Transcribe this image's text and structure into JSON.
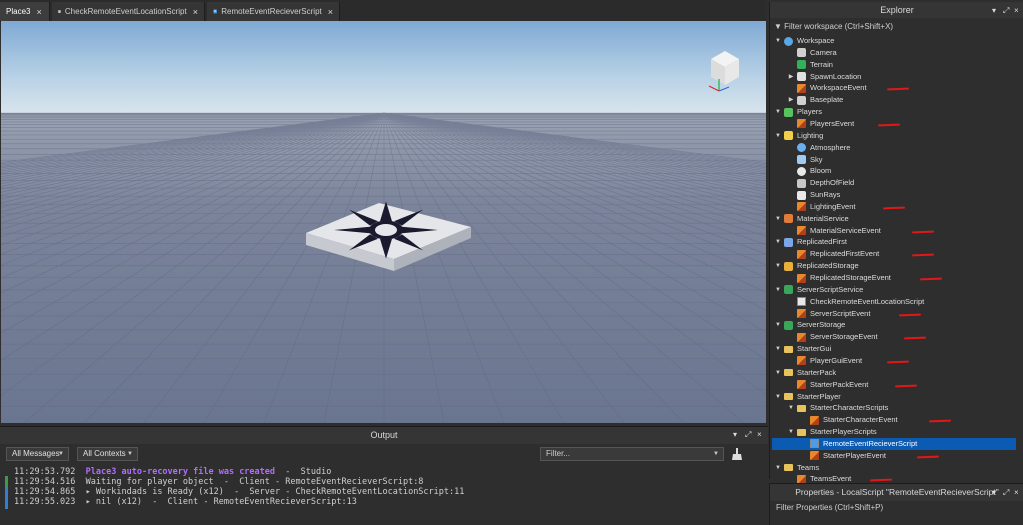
{
  "tabs": [
    {
      "label": "Place3",
      "active": true,
      "icon": "none"
    },
    {
      "label": "CheckRemoteEventLocationScript",
      "active": false,
      "icon": "script-icon"
    },
    {
      "label": "RemoteEventRecieverScript",
      "active": false,
      "icon": "local-script-icon"
    }
  ],
  "tab_close_glyph": "×",
  "output": {
    "title": "Output",
    "messages_filter": "All Messages",
    "contexts_filter": "All Contexts",
    "filter_placeholder": "Filter...",
    "lines": [
      {
        "time": "11:29:53.792",
        "text": "Place3 auto-recovery file was created",
        "suffix": "  -  Studio",
        "color": "#b26cff"
      },
      {
        "time": "11:29:54.516",
        "text": "Waiting for player object  -  Client - RemoteEventRecieverScript:8",
        "suffix": "",
        "color": "#d0d0d0"
      },
      {
        "time": "11:29:54.865",
        "text": "▸ Workindads is Ready (x12)  -  Server - CheckRemoteEventLocationScript:11",
        "suffix": "",
        "color": "#d0d0d0"
      },
      {
        "time": "11:29:55.023",
        "text": "▸ nil (x12)  -  Client - RemoteEventRecieverScript:13",
        "suffix": "",
        "color": "#d0d0d0"
      }
    ]
  },
  "explorer": {
    "title": "Explorer",
    "filter": "Filter workspace (Ctrl+Shift+X)",
    "items": [
      {
        "label": "Workspace",
        "depth": 0,
        "arrow": "down",
        "icon": "workspace-icon",
        "mark": false
      },
      {
        "label": "Camera",
        "depth": 1,
        "arrow": "none",
        "icon": "camera-icon",
        "mark": false
      },
      {
        "label": "Terrain",
        "depth": 1,
        "arrow": "none",
        "icon": "terrain-icon",
        "mark": false
      },
      {
        "label": "SpawnLocation",
        "depth": 1,
        "arrow": "right",
        "icon": "spawn-icon",
        "mark": false
      },
      {
        "label": "WorkspaceEvent",
        "depth": 1,
        "arrow": "none",
        "icon": "remote-event-icon",
        "mark": true
      },
      {
        "label": "Baseplate",
        "depth": 1,
        "arrow": "right",
        "icon": "part-icon",
        "mark": false
      },
      {
        "label": "Players",
        "depth": 0,
        "arrow": "down",
        "icon": "players-icon",
        "mark": false
      },
      {
        "label": "PlayersEvent",
        "depth": 1,
        "arrow": "none",
        "icon": "remote-event-icon",
        "mark": true
      },
      {
        "label": "Lighting",
        "depth": 0,
        "arrow": "down",
        "icon": "lighting-icon",
        "mark": false
      },
      {
        "label": "Atmosphere",
        "depth": 1,
        "arrow": "none",
        "icon": "atmosphere-icon",
        "mark": false
      },
      {
        "label": "Sky",
        "depth": 1,
        "arrow": "none",
        "icon": "sky-icon",
        "mark": false
      },
      {
        "label": "Bloom",
        "depth": 1,
        "arrow": "none",
        "icon": "bloom-icon",
        "mark": false
      },
      {
        "label": "DepthOfField",
        "depth": 1,
        "arrow": "none",
        "icon": "depth-of-field-icon",
        "mark": false
      },
      {
        "label": "SunRays",
        "depth": 1,
        "arrow": "none",
        "icon": "sunrays-icon",
        "mark": false
      },
      {
        "label": "LightingEvent",
        "depth": 1,
        "arrow": "none",
        "icon": "remote-event-icon",
        "mark": true
      },
      {
        "label": "MaterialService",
        "depth": 0,
        "arrow": "down",
        "icon": "material-service-icon",
        "mark": false
      },
      {
        "label": "MaterialServiceEvent",
        "depth": 1,
        "arrow": "none",
        "icon": "remote-event-icon",
        "mark": true
      },
      {
        "label": "ReplicatedFirst",
        "depth": 0,
        "arrow": "down",
        "icon": "replicated-first-icon",
        "mark": false
      },
      {
        "label": "ReplicatedFirstEvent",
        "depth": 1,
        "arrow": "none",
        "icon": "remote-event-icon",
        "mark": true
      },
      {
        "label": "ReplicatedStorage",
        "depth": 0,
        "arrow": "down",
        "icon": "replicated-storage-icon",
        "mark": false
      },
      {
        "label": "ReplicatedStorageEvent",
        "depth": 1,
        "arrow": "none",
        "icon": "remote-event-icon",
        "mark": true
      },
      {
        "label": "ServerScriptService",
        "depth": 0,
        "arrow": "down",
        "icon": "server-script-service-icon",
        "mark": false
      },
      {
        "label": "CheckRemoteEventLocationScript",
        "depth": 1,
        "arrow": "none",
        "icon": "script-icon",
        "mark": false
      },
      {
        "label": "ServerScriptEvent",
        "depth": 1,
        "arrow": "none",
        "icon": "remote-event-icon",
        "mark": true
      },
      {
        "label": "ServerStorage",
        "depth": 0,
        "arrow": "down",
        "icon": "server-storage-icon",
        "mark": false
      },
      {
        "label": "ServerStorageEvent",
        "depth": 1,
        "arrow": "none",
        "icon": "remote-event-icon",
        "mark": true
      },
      {
        "label": "StarterGui",
        "depth": 0,
        "arrow": "down",
        "icon": "folder-icon",
        "mark": false
      },
      {
        "label": "PlayerGuiEvent",
        "depth": 1,
        "arrow": "none",
        "icon": "remote-event-icon",
        "mark": true
      },
      {
        "label": "StarterPack",
        "depth": 0,
        "arrow": "down",
        "icon": "folder-icon",
        "mark": false
      },
      {
        "label": "StarterPackEvent",
        "depth": 1,
        "arrow": "none",
        "icon": "remote-event-icon",
        "mark": true
      },
      {
        "label": "StarterPlayer",
        "depth": 0,
        "arrow": "down",
        "icon": "folder-icon",
        "mark": false
      },
      {
        "label": "StarterCharacterScripts",
        "depth": 1,
        "arrow": "down",
        "icon": "folder-icon",
        "mark": false
      },
      {
        "label": "StarterCharacterEvent",
        "depth": 2,
        "arrow": "none",
        "icon": "remote-event-icon",
        "mark": true
      },
      {
        "label": "StarterPlayerScripts",
        "depth": 1,
        "arrow": "down",
        "icon": "folder-icon",
        "mark": false
      },
      {
        "label": "RemoteEventRecieverScript",
        "depth": 2,
        "arrow": "none",
        "icon": "local-script-icon",
        "mark": false,
        "selected": true
      },
      {
        "label": "StarterPlayerEvent",
        "depth": 2,
        "arrow": "none",
        "icon": "remote-event-icon",
        "mark": true
      },
      {
        "label": "Teams",
        "depth": 0,
        "arrow": "down",
        "icon": "teams-icon",
        "mark": false
      },
      {
        "label": "TeamsEvent",
        "depth": 1,
        "arrow": "none",
        "icon": "remote-event-icon",
        "mark": true
      }
    ]
  },
  "properties": {
    "title": "Properties - LocalScript \"RemoteEventRecieverScript\"",
    "filter": "Filter Properties (Ctrl+Shift+P)"
  },
  "colors": {
    "selection": "#0b5bb3",
    "annotation": "#e01818",
    "sky_top": "#8fb8de",
    "baseplate": "#6f7a92"
  }
}
